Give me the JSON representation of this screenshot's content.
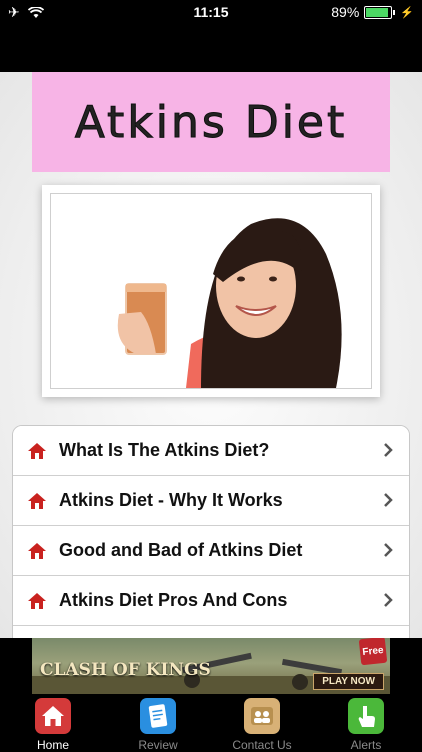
{
  "status_bar": {
    "time": "11:15",
    "battery_percent": "89%"
  },
  "header": {
    "title": "Atkins Diet"
  },
  "menu": {
    "items": [
      {
        "label": "What Is The Atkins Diet?"
      },
      {
        "label": "Atkins Diet - Why It Works"
      },
      {
        "label": "Good and Bad of Atkins Diet"
      },
      {
        "label": "Atkins Diet Pros And Cons"
      }
    ]
  },
  "ad": {
    "title": "CLASH OF KINGS",
    "badge": "Free",
    "cta": "PLAY NOW"
  },
  "tabs": [
    {
      "label": "Home",
      "icon": "home-icon",
      "active": true
    },
    {
      "label": "Review",
      "icon": "review-icon",
      "active": false
    },
    {
      "label": "Contact Us",
      "icon": "contact-icon",
      "active": false
    },
    {
      "label": "Alerts",
      "icon": "alerts-icon",
      "active": false
    }
  ],
  "colors": {
    "banner_bg": "#f7b4e6",
    "icon_red": "#c9221f",
    "tab_home": "#d43a3a",
    "tab_review": "#2a8fe0",
    "tab_contact": "#d8b176",
    "tab_alerts": "#4bb83a"
  }
}
